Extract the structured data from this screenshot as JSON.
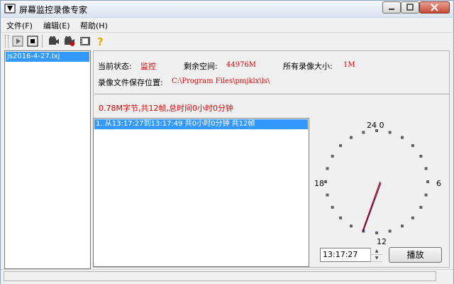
{
  "app": {
    "title": "屏幕监控录像专家"
  },
  "menu": [
    "文件(F)",
    "编辑(E)",
    "帮助(H)"
  ],
  "toolbar": {
    "icons": [
      "play-icon",
      "stop-icon",
      "camera-icon",
      "camera-record-icon",
      "film-icon",
      "help-icon"
    ]
  },
  "files": {
    "items": [
      "js2016-4-27.lxj"
    ]
  },
  "info": {
    "status_label": "当前状态:",
    "status_value": "监控",
    "free_label": "剩余空间:",
    "free_value": "44976M",
    "total_label": "所有录像大小:",
    "total_value": "1M",
    "path_label": "录像文件保存位置:",
    "path_value": "C:\\Program Files\\pmjklx\\ls\\"
  },
  "summary": "0.78M字节,共12帧,总时间0小时0分钟",
  "records": [
    "1. 从13:17:27到13:17:49 共0小时0分钟 共12帧"
  ],
  "clock": {
    "top": "24 0",
    "right": "6",
    "bottom": "12",
    "left": "18"
  },
  "time_input": "13:17:27",
  "play_button": "播放",
  "colors": {
    "highlight": "#3399ff",
    "accent_red": "#e00000"
  }
}
